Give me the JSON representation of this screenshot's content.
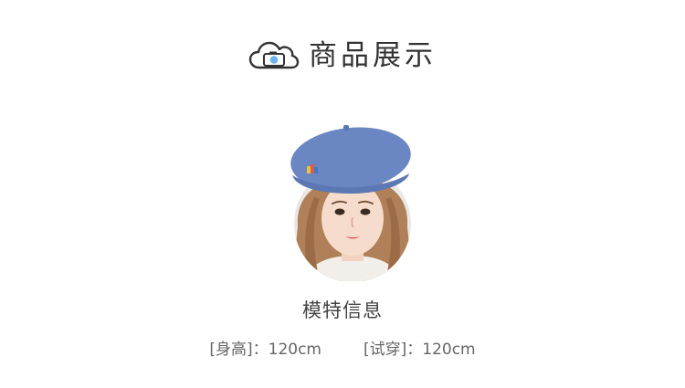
{
  "header": {
    "title": "商品展示",
    "icon": "cloud-camera-icon",
    "icon_accent": "#6ab4f5"
  },
  "photo": {
    "subject": "model-photo",
    "beret_color": "#6a87c4"
  },
  "model": {
    "label": "模特信息",
    "specs": [
      {
        "key": "[身高]：",
        "value": "120cm"
      },
      {
        "key": "[试穿]：",
        "value": "120cm"
      }
    ]
  }
}
